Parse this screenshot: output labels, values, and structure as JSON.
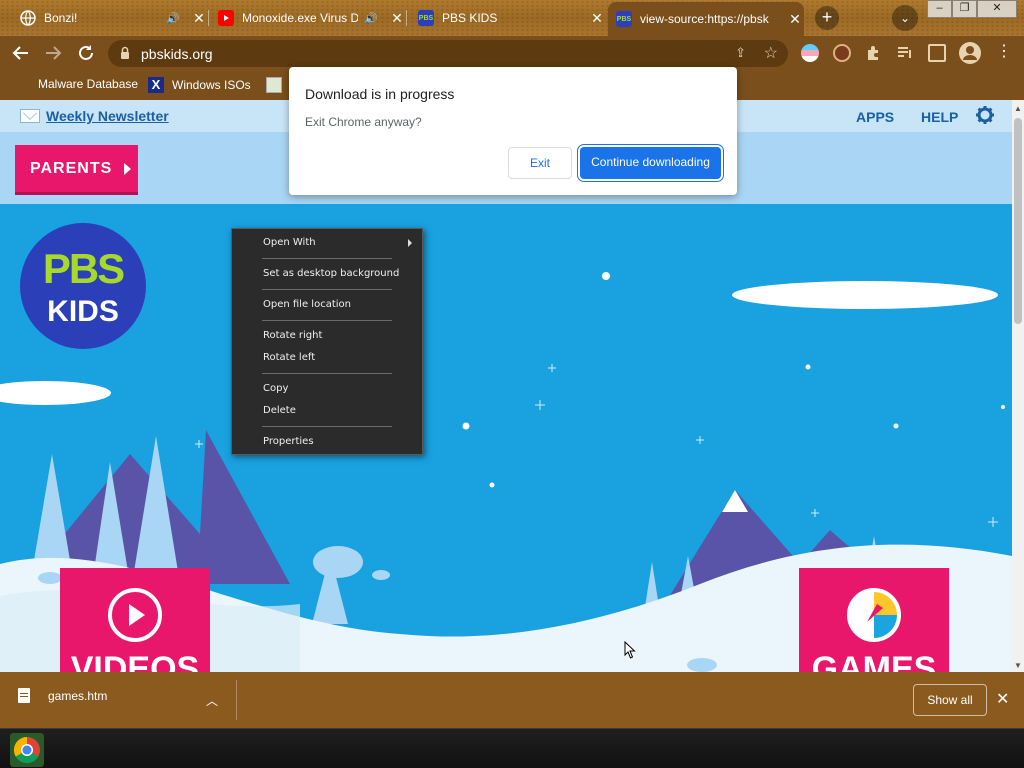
{
  "tabs": [
    {
      "title": "Bonzi!",
      "favicon": "globe-icon"
    },
    {
      "title": "Monoxide.exe Virus D",
      "favicon": "youtube-icon"
    },
    {
      "title": "PBS KIDS",
      "favicon": "pbs-icon"
    },
    {
      "title": "view-source:https://pbsk",
      "favicon": "pbs-icon"
    }
  ],
  "toolbar": {
    "url": "pbskids.org"
  },
  "bookmarks": [
    {
      "label": "Malware Database"
    },
    {
      "label": "Windows ISOs"
    }
  ],
  "page": {
    "newsletter": "Weekly Newsletter",
    "apps": "APPS",
    "help": "HELP",
    "parents": "PARENTS",
    "logo_top": "PBS",
    "logo_bottom": "KIDS",
    "videos": "VIDEOS",
    "games": "GAMES"
  },
  "dialog": {
    "title": "Download is in progress",
    "message": "Exit Chrome anyway?",
    "exit": "Exit",
    "continue": "Continue downloading"
  },
  "context_menu": {
    "items": [
      "Open With",
      "Set as desktop background",
      "Open file location",
      "Rotate right",
      "Rotate left",
      "Copy",
      "Delete",
      "Properties"
    ]
  },
  "download_shelf": {
    "filename": "games.htm",
    "show_all": "Show all"
  },
  "colors": {
    "chrome_brown": "#7a4f1b",
    "pbs_pink": "#e8176b",
    "sky_blue": "#19a1e0",
    "chrome_blue": "#1a73e8"
  }
}
